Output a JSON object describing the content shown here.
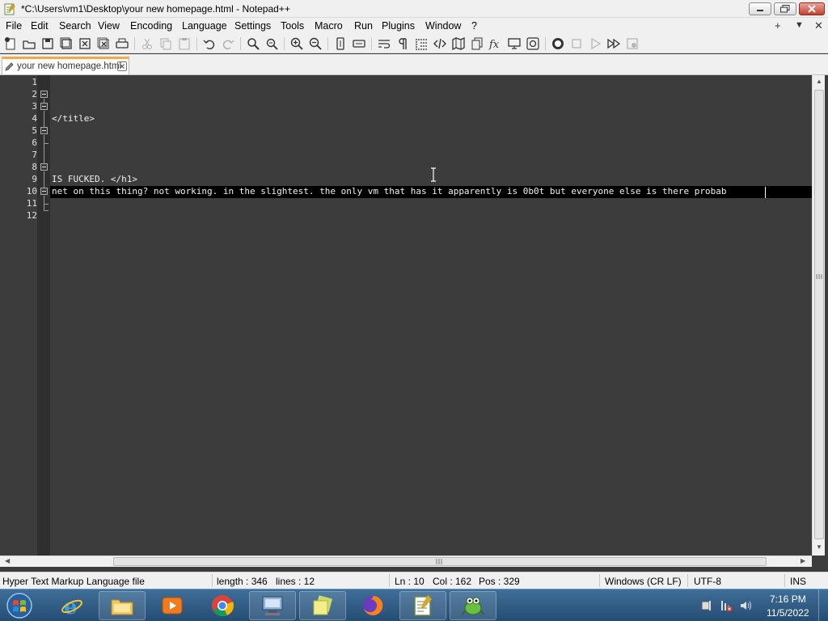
{
  "window": {
    "title": "*C:\\Users\\vm1\\Desktop\\your new homepage.html - Notepad++"
  },
  "menubar": {
    "items": [
      "File",
      "Edit",
      "Search",
      "View",
      "Encoding",
      "Language",
      "Settings",
      "Tools",
      "Macro",
      "Run",
      "Plugins",
      "Window",
      "?"
    ],
    "right_controls": [
      "+",
      "▼",
      "✕"
    ]
  },
  "toolbar": {
    "icons": [
      "new-file-icon",
      "open-file-icon",
      "save-icon",
      "save-all-icon",
      "close-icon",
      "close-all-icon",
      "print-icon",
      "cut-icon",
      "copy-icon",
      "paste-icon",
      "undo-icon",
      "redo-icon",
      "find-icon",
      "replace-icon",
      "zoom-in-icon",
      "zoom-out-icon",
      "sync-vertical-icon",
      "sync-horizontal-icon",
      "word-wrap-icon",
      "show-all-chars-icon",
      "indent-guide-icon",
      "udl-icon",
      "document-map-icon",
      "document-list-icon",
      "function-list-icon",
      "folder-as-workspace-icon",
      "monitoring-icon",
      "record-macro-icon",
      "stop-macro-icon",
      "play-macro-icon",
      "run-macro-multiple-icon",
      "save-macro-icon"
    ]
  },
  "tabs": [
    {
      "label": "your new homepage.html",
      "modified": true,
      "active": true
    }
  ],
  "editor": {
    "line_numbers": [
      "1",
      "2",
      "3",
      "4",
      "5",
      "6",
      "7",
      "8",
      "9",
      "10",
      "11",
      "12"
    ],
    "lines": [
      "",
      "",
      "",
      "</title>",
      "",
      "",
      "",
      "",
      "IS FUCKED. </h1>",
      "net on this thing? not working. in the slightest. the only vm that has it apparently is 0b0t but everyone else is there probab",
      "",
      ""
    ],
    "current_line": 10,
    "colors": {
      "background": "#3c3c3c",
      "current_line": "#000000",
      "text": "#f0f0f0"
    }
  },
  "statusbar": {
    "file_type": "Hyper Text Markup Language file",
    "length": "length : 346",
    "lines": "lines : 12",
    "ln": "Ln : 10",
    "col": "Col : 162",
    "pos": "Pos : 329",
    "eol": "Windows (CR LF)",
    "encoding": "UTF-8",
    "mode": "INS"
  },
  "taskbar": {
    "apps": [
      "internet-explorer",
      "windows-explorer",
      "media-player",
      "chrome",
      "remote-desktop",
      "sticky-notes",
      "firefox",
      "notepad-plus-plus",
      "gecko-app"
    ],
    "clock": {
      "time": "7:16 PM",
      "date": "11/5/2022"
    }
  }
}
